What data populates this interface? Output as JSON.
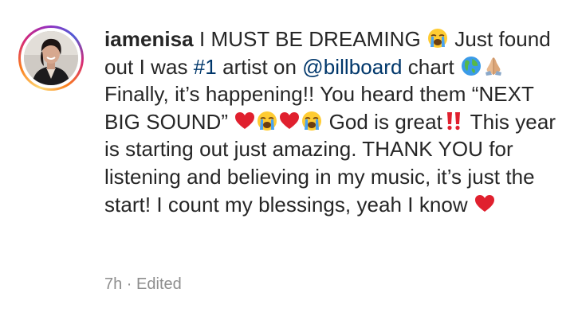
{
  "post": {
    "username": "iamenisa",
    "caption": {
      "t1": " I MUST BE DREAMING ",
      "t2": " Just found out I was ",
      "hashtag": "#1",
      "t3": " artist on ",
      "mention": "@billboard",
      "t4": " chart ",
      "t5": " Finally, it’s happening!! You heard them “NEXT BIG SOUND” ",
      "t6": " God is great",
      "t7": " This year is starting out just amazing. THANK YOU for listening and believing in my music, it’s just the start! I count my blessings, yeah I know "
    },
    "meta": {
      "time": "7h",
      "separator": " · ",
      "edited": "Edited"
    },
    "emoji_names": [
      "loudly-crying-face",
      "earth-globe",
      "folded-hands",
      "red-heart",
      "double-exclamation"
    ],
    "colors": {
      "text": "#262626",
      "link": "#00376b",
      "meta": "#8e8e8e",
      "heart": "#e0202e"
    }
  }
}
